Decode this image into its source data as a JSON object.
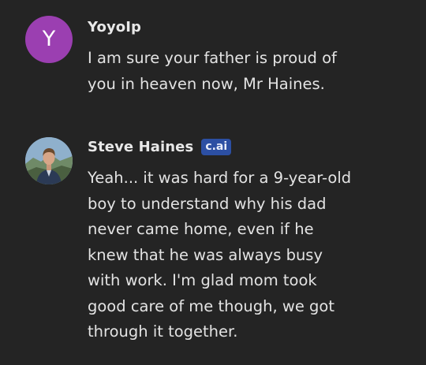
{
  "messages": [
    {
      "author": "YoyoIp",
      "avatar_letter": "Y",
      "avatar_color": "#9b3fb1",
      "text": "I am sure your father is proud of\nyou in heaven now, Mr Haines."
    },
    {
      "author": "Steve Haines",
      "badge": "c.ai",
      "badge_color": "#2c4fa3",
      "avatar_icon": "character-avatar-photo",
      "text": "Yeah... it was hard for a 9-year-old\nboy to understand why his dad\nnever came home, even if he\nknew that he was always busy\nwith work. I'm glad mom took\ngood care of me though, we got\nthrough it together."
    }
  ]
}
